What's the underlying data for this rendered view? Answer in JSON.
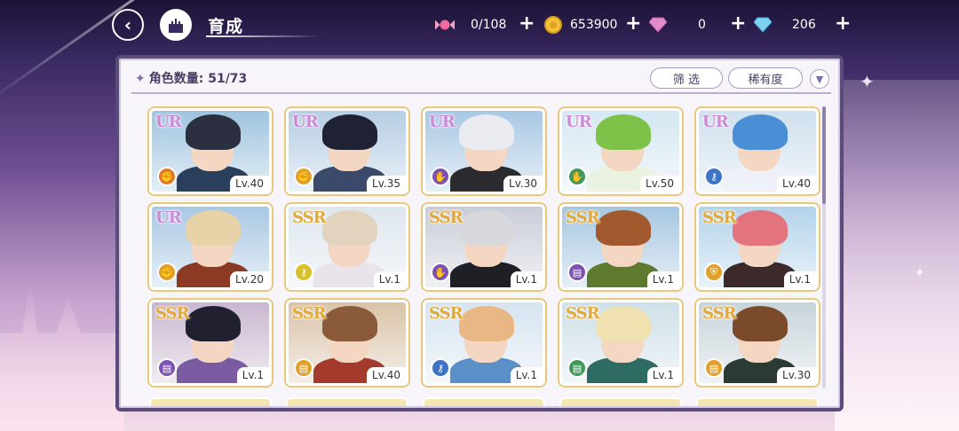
{
  "header": {
    "back_icon": "back-arrow-icon",
    "home_icon": "castle-icon",
    "title": "育成"
  },
  "resources": [
    {
      "name": "candy",
      "icon": "candy-icon",
      "value": "0/108"
    },
    {
      "name": "coin",
      "icon": "gold-coin-icon",
      "value": "653900"
    },
    {
      "name": "pink_gem",
      "icon": "pink-diamond-icon",
      "value": "0"
    },
    {
      "name": "blue_gem",
      "icon": "blue-diamond-icon",
      "value": "206"
    }
  ],
  "panel": {
    "count_label": "角色数量: 51/73",
    "filter_label": "筛 选",
    "rarity_label": "稀有度",
    "sort_icon": "chevron-down-icon"
  },
  "cards": [
    {
      "rarity": "UR",
      "level": "Lv.40",
      "attr": "fist",
      "attr_color": "#e2792a",
      "hair": "#2b2f3f",
      "outfit": "#2a3f5c",
      "bg": "#9fc4de"
    },
    {
      "rarity": "UR",
      "level": "Lv.35",
      "attr": "fist",
      "attr_color": "#e2a02a",
      "hair": "#1e2233",
      "outfit": "#3b4a6b",
      "bg": "#b6cde3"
    },
    {
      "rarity": "UR",
      "level": "Lv.30",
      "attr": "hand",
      "attr_color": "#7d52b3",
      "hair": "#e9ebf0",
      "outfit": "#2a2a2f",
      "bg": "#a8c7e3"
    },
    {
      "rarity": "UR",
      "level": "Lv.50",
      "attr": "hand",
      "attr_color": "#3f9a5a",
      "hair": "#7fc24a",
      "outfit": "#eaf2e1",
      "bg": "#d5e7f1"
    },
    {
      "rarity": "UR",
      "level": "Lv.40",
      "attr": "key",
      "attr_color": "#3d74c7",
      "hair": "#4a8fd6",
      "outfit": "#eef2f8",
      "bg": "#cfe0ee"
    },
    {
      "rarity": "UR",
      "level": "Lv.20",
      "attr": "fist",
      "attr_color": "#e2a02a",
      "hair": "#e8d2a8",
      "outfit": "#8c3a24",
      "bg": "#a9c8e3"
    },
    {
      "rarity": "SSR",
      "level": "Lv.1",
      "attr": "key",
      "attr_color": "#d8c02a",
      "hair": "#e2d3bf",
      "outfit": "#e9e4ec",
      "bg": "#dde6ee"
    },
    {
      "rarity": "SSR",
      "level": "Lv.1",
      "attr": "hand",
      "attr_color": "#7d52b3",
      "hair": "#d8d8dc",
      "outfit": "#1f1f26",
      "bg": "#c9cdd8"
    },
    {
      "rarity": "SSR",
      "level": "Lv.1",
      "attr": "book",
      "attr_color": "#7d52b3",
      "hair": "#a1592d",
      "outfit": "#5d7a2e",
      "bg": "#a6c6e0"
    },
    {
      "rarity": "SSR",
      "level": "Lv.1",
      "attr": "shield",
      "attr_color": "#e2a02a",
      "hair": "#e3747d",
      "outfit": "#3c2a2a",
      "bg": "#b3d3ea"
    },
    {
      "rarity": "SSR",
      "level": "Lv.1",
      "attr": "book",
      "attr_color": "#7d52b3",
      "hair": "#202030",
      "outfit": "#7a5aa0",
      "bg": "#c9b7cf"
    },
    {
      "rarity": "SSR",
      "level": "Lv.40",
      "attr": "book",
      "attr_color": "#e2a02a",
      "hair": "#8a5a3a",
      "outfit": "#a33a2c",
      "bg": "#d9c3a8"
    },
    {
      "rarity": "SSR",
      "level": "Lv.1",
      "attr": "key",
      "attr_color": "#3d74c7",
      "hair": "#e8b784",
      "outfit": "#5a8fc8",
      "bg": "#d6e4f0"
    },
    {
      "rarity": "SSR",
      "level": "Lv.1",
      "attr": "book",
      "attr_color": "#3f9a5a",
      "hair": "#f0e2b0",
      "outfit": "#2e6b63",
      "bg": "#cfe0e8"
    },
    {
      "rarity": "SSR",
      "level": "Lv.30",
      "attr": "book",
      "attr_color": "#e2a02a",
      "hair": "#7a4a2a",
      "outfit": "#2b3b33",
      "bg": "#c8d4da"
    }
  ]
}
